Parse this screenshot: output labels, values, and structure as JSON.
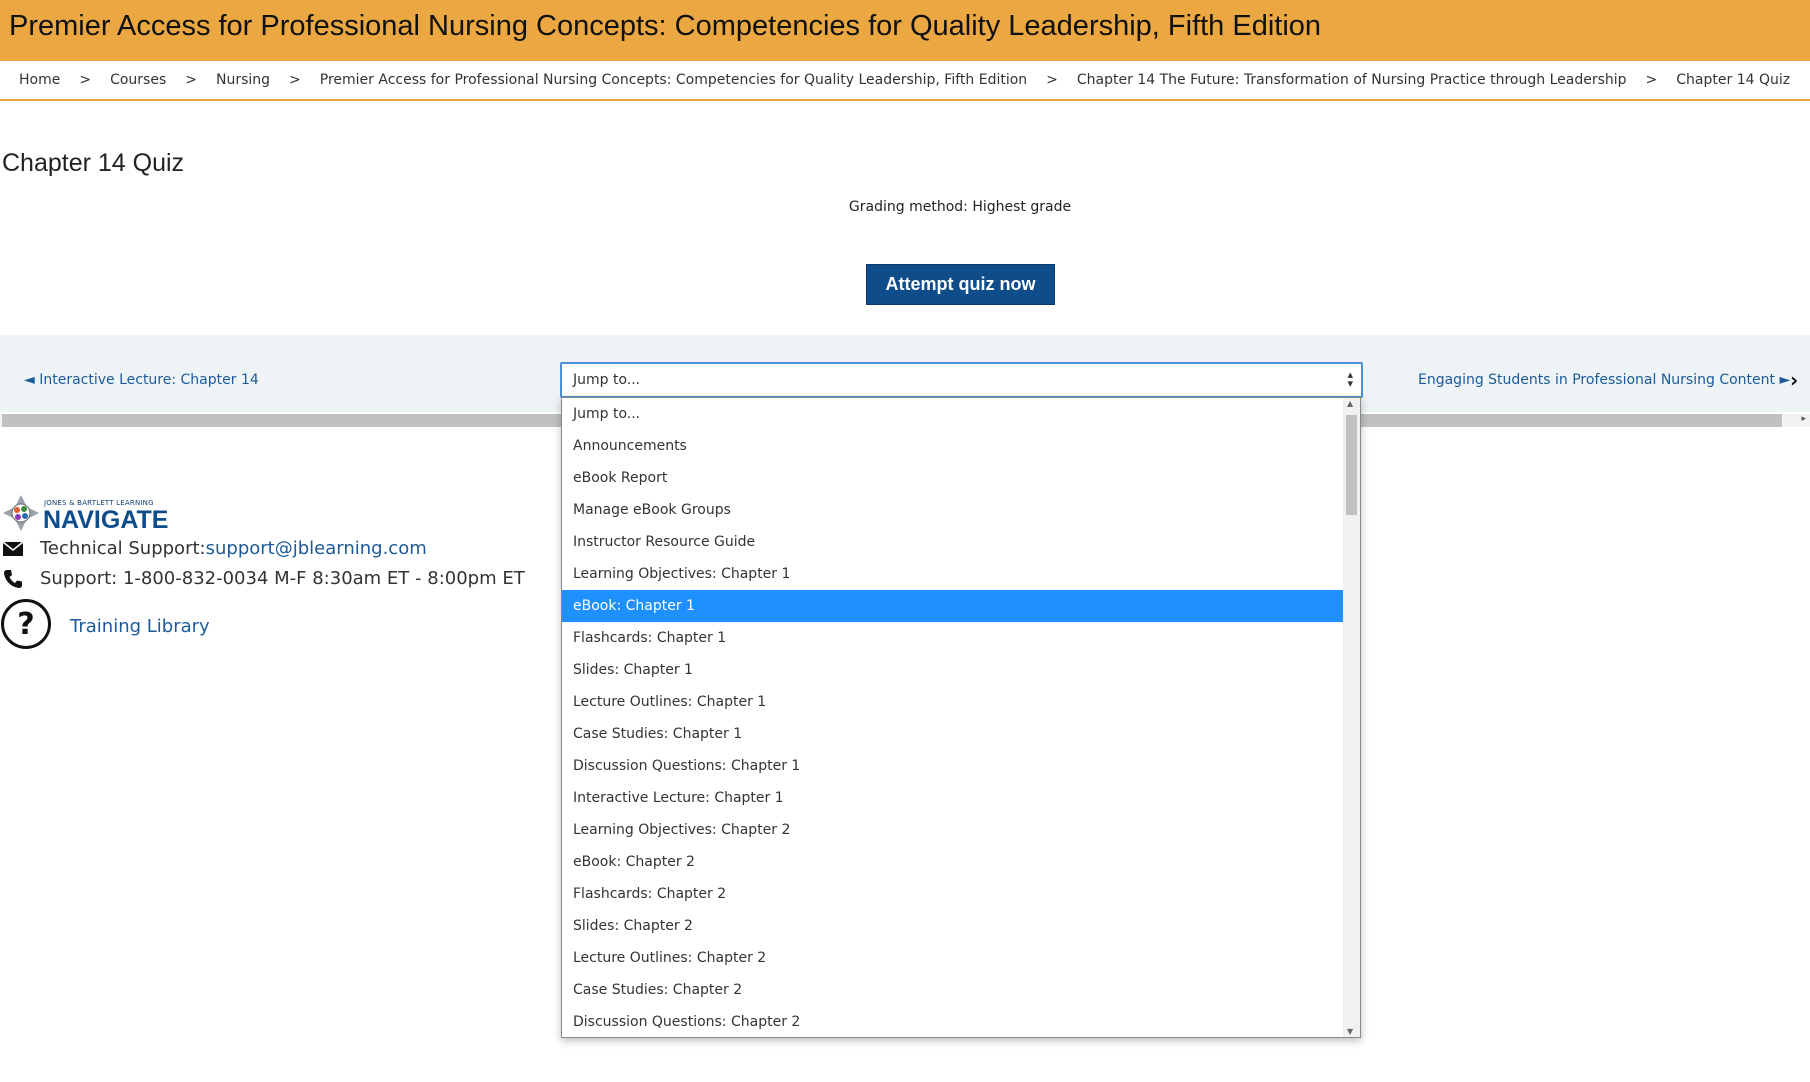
{
  "header": {
    "title": "Premier Access for Professional Nursing Concepts: Competencies for Quality Leadership, Fifth Edition"
  },
  "breadcrumb": {
    "separator": ">",
    "items": [
      "Home",
      "Courses",
      "Nursing",
      "Premier Access for Professional Nursing Concepts: Competencies for Quality Leadership, Fifth Edition",
      "Chapter 14 The Future: Transformation of Nursing Practice through Leadership",
      "Chapter 14 Quiz"
    ]
  },
  "main": {
    "title": "Chapter 14 Quiz",
    "grading_method": "Grading method: Highest grade",
    "attempt_label": "Attempt quiz now"
  },
  "activity_nav": {
    "prev_label": "◄ Interactive Lecture: Chapter 14",
    "next_label": "Engaging Students in Professional Nursing Content ►",
    "jump_value": "Jump to...",
    "options": [
      "Jump to...",
      "Announcements",
      "eBook Report",
      "Manage eBook Groups",
      "Instructor Resource Guide",
      "Learning Objectives: Chapter 1",
      "eBook: Chapter 1",
      "Flashcards: Chapter 1",
      "Slides: Chapter 1",
      "Lecture Outlines: Chapter 1",
      "Case Studies: Chapter 1",
      "Discussion Questions: Chapter 1",
      "Interactive Lecture: Chapter 1",
      "Learning Objectives: Chapter 2",
      "eBook: Chapter 2",
      "Flashcards: Chapter 2",
      "Slides: Chapter 2",
      "Lecture Outlines: Chapter 2",
      "Case Studies: Chapter 2",
      "Discussion Questions: Chapter 2"
    ],
    "highlighted_option": "eBook: Chapter 1"
  },
  "footer": {
    "logo_small": "JONES & BARTLETT LEARNING",
    "logo_big": "NAVIGATE",
    "tech_support_label": "Technical Support:",
    "tech_support_email": "support@jblearning.com",
    "phone_support": "Support: 1-800-832-0034 M-F 8:30am ET - 8:00pm ET",
    "training_library": "Training Library"
  },
  "colors": {
    "header_bg": "#eaa742",
    "primary_button": "#0f4c8a",
    "link": "#1c5a9a",
    "highlight": "#1e90ff"
  }
}
